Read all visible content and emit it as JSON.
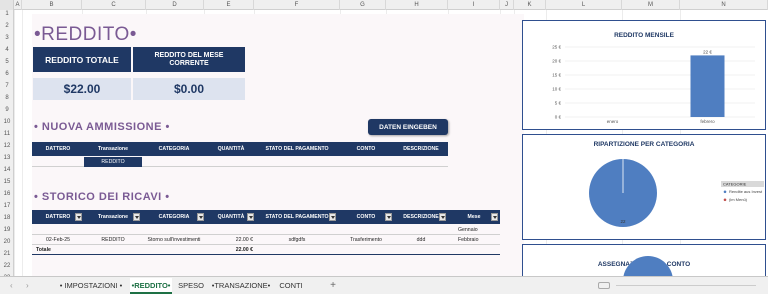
{
  "columns": [
    "A",
    "B",
    "C",
    "D",
    "E",
    "F",
    "G",
    "H",
    "I",
    "J",
    "K",
    "L",
    "M",
    "N"
  ],
  "rows": [
    "1",
    "2",
    "3",
    "4",
    "5",
    "6",
    "7",
    "8",
    "9",
    "10",
    "11",
    "12",
    "13",
    "14",
    "15",
    "16",
    "17",
    "18",
    "19",
    "20",
    "21",
    "22",
    "23"
  ],
  "page": {
    "title": "•REDDITO•",
    "kpi": {
      "total_label": "REDDITO TOTALE",
      "total_value": "$22.00",
      "month_label": "REDDITO DEL MESE CORRENTE",
      "month_value": "$0.00"
    },
    "new_section_title": "• NUOVA AMMISSIONE •",
    "enter_button": "DATEN EINGEBEN",
    "new_table": {
      "headers": [
        "DATTERO",
        "Transazione",
        "CATEGORIA",
        "QUANTITÀ",
        "STATO DEL PAGAMENTO",
        "CONTO",
        "DESCRIZIONE"
      ],
      "row": [
        "",
        "REDDITO",
        "",
        "",
        "",
        "",
        ""
      ]
    },
    "history_title": "• STORICO DEI RICAVI •",
    "history_table": {
      "headers": [
        "DATTERO",
        "Transazione",
        "CATEGORIA",
        "QUANTITÀ",
        "STATO DEL PAGAMENTO",
        "CONTO",
        "DESCRIZIONE",
        "Mese"
      ],
      "rows": [
        [
          "",
          "",
          "",
          "",
          "",
          "",
          "",
          "Gennaio"
        ],
        [
          "02-Feb-25",
          "REDDITO",
          "Storno sull'investimenti",
          "22.00 €",
          "sdfgdfs",
          "Trasferimento",
          "ddd",
          "Febbraio"
        ]
      ],
      "total_label": "Totale",
      "total_value": "22.00 €"
    }
  },
  "charts": {
    "monthly": {
      "title": "REDDITO MENSILE"
    },
    "category": {
      "title": "RIPARTIZIONE PER CATEGORIA"
    },
    "account": {
      "title": "ASSEGNAZIONE PER CONTO"
    }
  },
  "chart_data": [
    {
      "type": "bar",
      "title": "REDDITO MENSILE",
      "categories": [
        "enero",
        "febrero"
      ],
      "values": [
        0,
        22
      ],
      "data_labels": [
        "",
        "22 €"
      ],
      "yticks": [
        "0 €",
        "5 €",
        "10 €",
        "15 €",
        "20 €",
        "25 €"
      ],
      "ylim": [
        0,
        25
      ],
      "color": "#4f7ec1"
    },
    {
      "type": "pie",
      "title": "RIPARTIZIONE PER CATEGORIA",
      "legend_title": "CATEGORIE",
      "legend_position": "right",
      "slices": [
        {
          "label": "Rendite aus Invest",
          "value": 22,
          "color": "#4f7ec1"
        },
        {
          "label": "(im Menü)",
          "value": 0,
          "color": "#c0504d"
        }
      ],
      "slice_label": "22"
    },
    {
      "type": "pie",
      "title": "ASSEGNAZIONE PER CONTO"
    }
  ],
  "sheet_tabs": [
    "• IMPOSTAZIONI •",
    "•REDDITO•",
    "SPESO",
    "•TRANSAZIONE•",
    "CONTI"
  ],
  "active_tab": 1,
  "add_sheet_label": "+"
}
